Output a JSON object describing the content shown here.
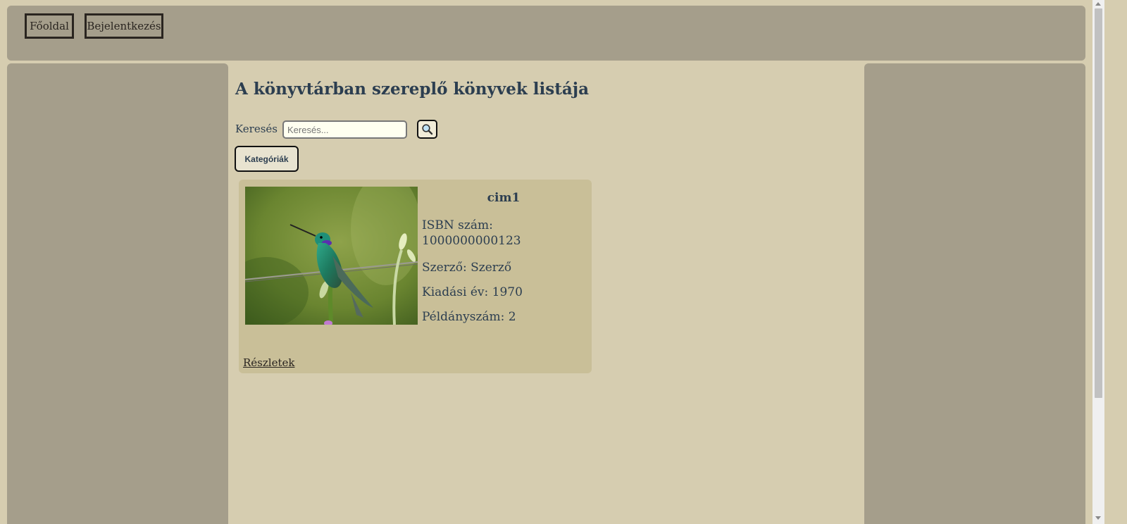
{
  "nav": {
    "home_label": "Főoldal",
    "login_label": "Bejelentkezés"
  },
  "page": {
    "title": "A könyvtárban szereplő könyvek listája"
  },
  "search": {
    "label": "Keresés",
    "placeholder": "Keresés...",
    "button_icon": "magnifier-icon"
  },
  "categories_button": "Kategóriák",
  "books": [
    {
      "title": "cim1",
      "isbn_label": "ISBN szám:",
      "isbn": "1000000000123",
      "author": "Szerző: Szerző",
      "year": "Kiadási év: 1970",
      "copies": "Példányszám: 2",
      "details_link": "Részletek",
      "image_icon": "hummingbird-photo"
    }
  ],
  "colors": {
    "page_bg": "#d6cdb0",
    "panel_bg": "#a59e8b",
    "card_bg": "#c9bf98",
    "text": "#2c3e50"
  }
}
